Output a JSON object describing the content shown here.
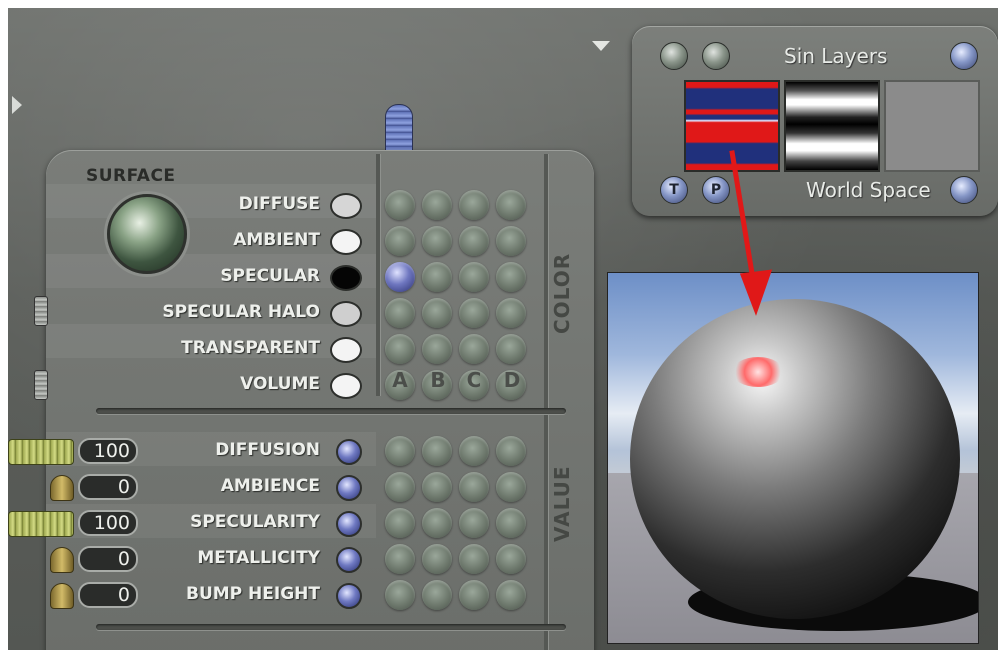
{
  "surface": {
    "title": "SURFACE",
    "channels": [
      {
        "label": "DIFFUSE",
        "swatch": "#d6d6d6"
      },
      {
        "label": "AMBIENT",
        "swatch": "#f4f4f4"
      },
      {
        "label": "SPECULAR",
        "swatch": "#050505"
      },
      {
        "label": "SPECULAR HALO",
        "swatch": "#cfcfcf"
      },
      {
        "label": "TRANSPARENT",
        "swatch": "#f4f4f4"
      },
      {
        "label": "VOLUME",
        "swatch": "#f4f4f4"
      }
    ],
    "color_section": "COLOR",
    "columns": [
      "A",
      "B",
      "C",
      "D"
    ],
    "value_section": "VALUE",
    "values": [
      {
        "label": "DIFFUSION",
        "value": "100",
        "slider": "bar"
      },
      {
        "label": "AMBIENCE",
        "value": "0",
        "slider": "knob"
      },
      {
        "label": "SPECULARITY",
        "value": "100",
        "slider": "bar"
      },
      {
        "label": "METALLICITY",
        "value": "0",
        "slider": "knob"
      },
      {
        "label": "BUMP HEIGHT",
        "value": "0",
        "slider": "knob"
      }
    ]
  },
  "layers": {
    "title": "Sin Layers",
    "space": "World Space",
    "btn_t": "T",
    "btn_p": "P"
  },
  "colors": {
    "accent_red": "#e01818",
    "accent_blue": "#20307c",
    "panel": "#6e716d"
  }
}
